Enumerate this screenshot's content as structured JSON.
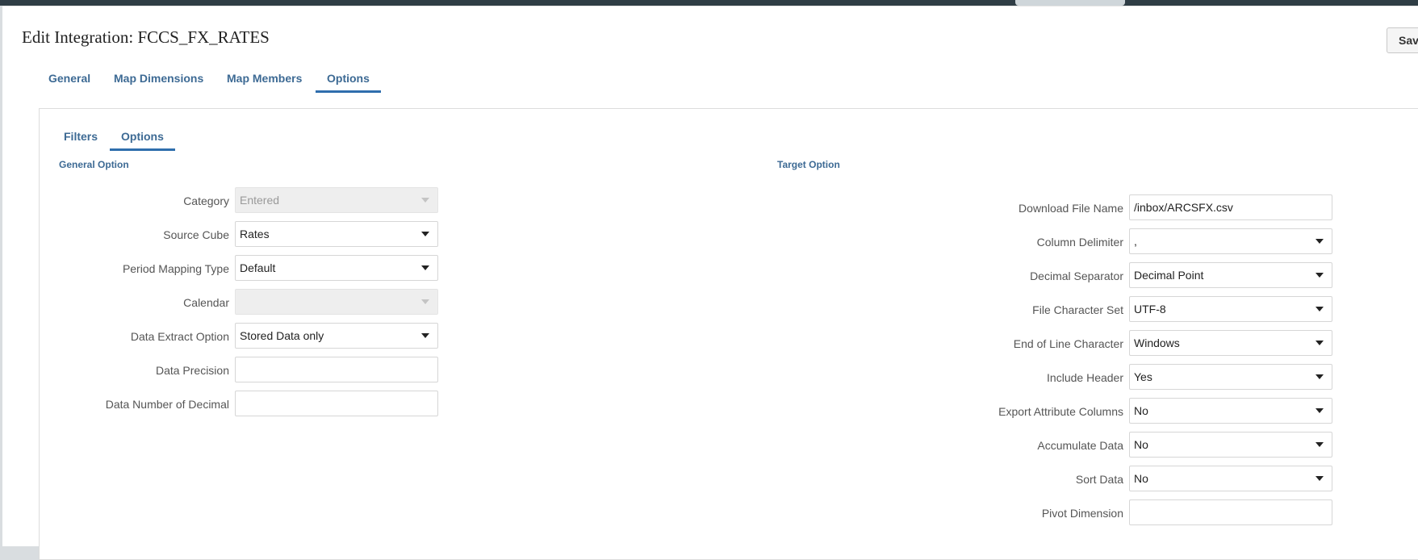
{
  "page": {
    "title": "Edit Integration: FCCS_FX_RATES",
    "save_label": "Save"
  },
  "main_tabs": [
    {
      "label": "General"
    },
    {
      "label": "Map Dimensions"
    },
    {
      "label": "Map Members"
    },
    {
      "label": "Options",
      "active": true
    }
  ],
  "sub_tabs": [
    {
      "label": "Filters"
    },
    {
      "label": "Options",
      "active": true
    }
  ],
  "general_option": {
    "title": "General Option",
    "fields": [
      {
        "label": "Category",
        "type": "select",
        "value": "Entered",
        "disabled": true
      },
      {
        "label": "Source Cube",
        "type": "select",
        "value": "Rates"
      },
      {
        "label": "Period Mapping Type",
        "type": "select",
        "value": "Default"
      },
      {
        "label": "Calendar",
        "type": "select",
        "value": "",
        "disabled": true
      },
      {
        "label": "Data Extract Option",
        "type": "select",
        "value": "Stored Data only"
      },
      {
        "label": "Data Precision",
        "type": "text",
        "value": ""
      },
      {
        "label": "Data Number of Decimal",
        "type": "text",
        "value": ""
      }
    ]
  },
  "target_option": {
    "title": "Target Option",
    "fields": [
      {
        "label": "Download File Name",
        "type": "text",
        "value": "/inbox/ARCSFX.csv"
      },
      {
        "label": "Column Delimiter",
        "type": "select",
        "value": ","
      },
      {
        "label": "Decimal Separator",
        "type": "select",
        "value": "Decimal Point"
      },
      {
        "label": "File Character Set",
        "type": "select",
        "value": "UTF-8"
      },
      {
        "label": "End of Line Character",
        "type": "select",
        "value": "Windows"
      },
      {
        "label": "Include Header",
        "type": "select",
        "value": "Yes"
      },
      {
        "label": "Export Attribute Columns",
        "type": "select",
        "value": "No"
      },
      {
        "label": "Accumulate Data",
        "type": "select",
        "value": "No"
      },
      {
        "label": "Sort Data",
        "type": "select",
        "value": "No"
      },
      {
        "label": "Pivot Dimension",
        "type": "text",
        "value": ""
      }
    ]
  },
  "colors": {
    "accent": "#2f6ead",
    "tab_text": "#3d6a94",
    "top_bar": "#2f3d45"
  }
}
